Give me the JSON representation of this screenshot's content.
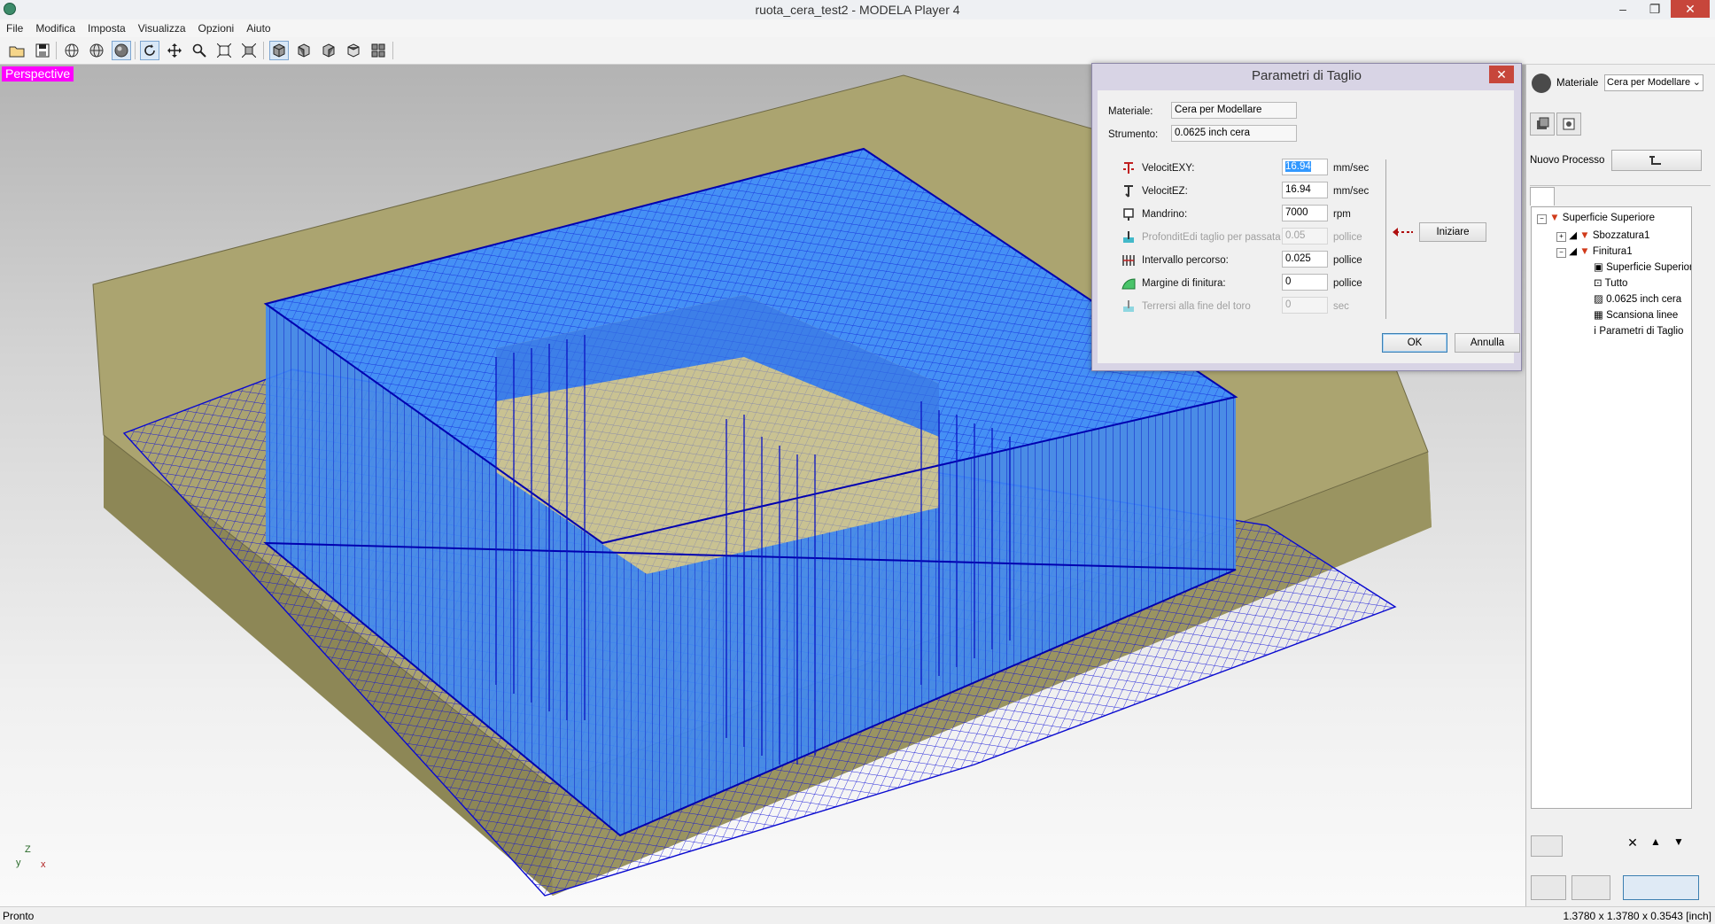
{
  "window": {
    "title": "ruota_cera_test2 - MODELA Player 4",
    "minimize": "–",
    "restore": "❐",
    "close": "✕"
  },
  "menu": [
    "File",
    "Modifica",
    "Imposta",
    "Visualizza",
    "Opzioni",
    "Aiuto"
  ],
  "toolbar": {
    "icons": [
      "open-folder-icon",
      "save-icon",
      "globe-wire-icon",
      "globe-icon",
      "sphere-render-icon",
      "rotate-icon",
      "pan-icon",
      "zoom-icon",
      "fit-window-icon",
      "fit-selection-icon",
      "view-iso-icon",
      "view-front-icon",
      "view-side-icon",
      "view-back-icon",
      "view-grid-icon"
    ]
  },
  "viewport": {
    "label": "Perspective",
    "axis": {
      "z": "Z",
      "y": "y",
      "x": "x"
    },
    "colors": {
      "stock": "#a7a06a",
      "model": "#3f8af3",
      "toolpath": "#0000cc"
    }
  },
  "dialog": {
    "title": "Parametri di Taglio",
    "close": "✕",
    "material_label": "Materiale:",
    "material_value": "Cera per Modellare",
    "tool_label": "Strumento:",
    "tool_value": "0.0625 inch cera",
    "params": [
      {
        "label": "VelocitEXY:",
        "value": "16.94",
        "unit": "mm/sec",
        "enabled": true,
        "selected": true
      },
      {
        "label": "VelocitEZ:",
        "value": "16.94",
        "unit": "mm/sec",
        "enabled": true
      },
      {
        "label": "Mandrino:",
        "value": "7000",
        "unit": "rpm",
        "enabled": true
      },
      {
        "label": "ProfonditEdi taglio per passata",
        "value": "0.05",
        "unit": "pollice",
        "enabled": false
      },
      {
        "label": "Intervallo percorso:",
        "value": "0.025",
        "unit": "pollice",
        "enabled": true
      },
      {
        "label": "Margine di finitura:",
        "value": "0",
        "unit": "pollice",
        "enabled": true
      },
      {
        "label": "Terrersi alla fine del toro",
        "value": "0",
        "unit": "sec",
        "enabled": false
      }
    ],
    "start_button": "Iniziare",
    "ok_button": "OK",
    "cancel_button": "Annulla"
  },
  "right_panel": {
    "material_label": "Materiale",
    "material_value": "Cera per Modellare",
    "new_process_label": "Nuovo Processo",
    "tree": [
      {
        "label": "Superficie Superiore",
        "level": 0,
        "expander": "−"
      },
      {
        "label": "Sbozzatura1",
        "level": 1,
        "expander": "+"
      },
      {
        "label": "Finitura1",
        "level": 1,
        "expander": "−"
      },
      {
        "label": "Superficie Superiore",
        "level": 2
      },
      {
        "label": "Tutto",
        "level": 2
      },
      {
        "label": "0.0625 inch cera",
        "level": 2
      },
      {
        "label": "Scansiona linee",
        "level": 2
      },
      {
        "label": "Parametri di Taglio",
        "level": 2
      }
    ]
  },
  "status": {
    "left": "Pronto",
    "right": "1.3780 x 1.3780 x 0.3543 [inch]"
  }
}
